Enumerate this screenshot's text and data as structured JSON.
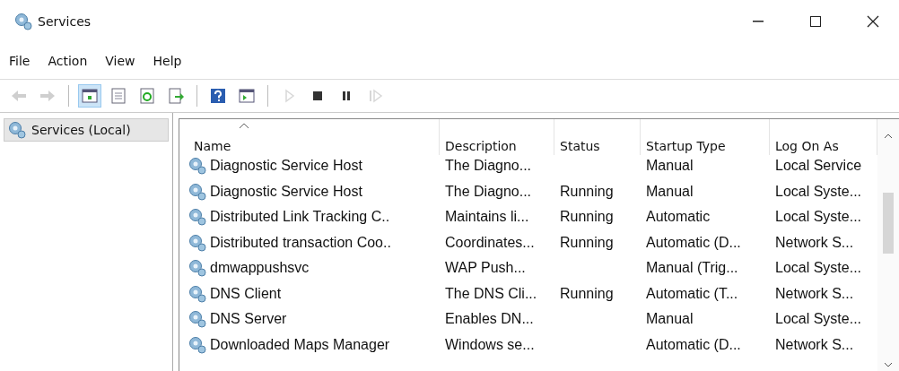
{
  "window": {
    "title": "Services"
  },
  "menu": [
    "File",
    "Action",
    "View",
    "Help"
  ],
  "toolbar": [
    {
      "kind": "back",
      "disabled": true,
      "selected": false
    },
    {
      "kind": "forward",
      "disabled": true,
      "selected": false
    },
    {
      "kind": "sep"
    },
    {
      "kind": "tree",
      "disabled": false,
      "selected": true
    },
    {
      "kind": "properties",
      "disabled": false,
      "selected": false
    },
    {
      "kind": "refresh",
      "disabled": false,
      "selected": false
    },
    {
      "kind": "export",
      "disabled": false,
      "selected": false
    },
    {
      "kind": "sep"
    },
    {
      "kind": "help",
      "disabled": false,
      "selected": false
    },
    {
      "kind": "view",
      "disabled": false,
      "selected": false
    },
    {
      "kind": "sep"
    },
    {
      "kind": "start",
      "disabled": true,
      "selected": false
    },
    {
      "kind": "stop",
      "disabled": false,
      "selected": false
    },
    {
      "kind": "pause",
      "disabled": false,
      "selected": false
    },
    {
      "kind": "resume",
      "disabled": true,
      "selected": false
    }
  ],
  "sidebar": {
    "items": [
      {
        "label": "Services (Local)",
        "selected": true
      }
    ]
  },
  "table": {
    "columns": [
      {
        "label": "Name",
        "sorted": true
      },
      {
        "label": "Description",
        "sorted": false
      },
      {
        "label": "Status",
        "sorted": false
      },
      {
        "label": "Startup Type",
        "sorted": false
      },
      {
        "label": "Log On As",
        "sorted": false
      }
    ],
    "rows": [
      {
        "name": "Diagnostic Service Host",
        "description": "The Diagno...",
        "startup_type": "Manual",
        "log_on_as": "Local Service"
      },
      {
        "name": "Diagnostic Service Host",
        "description": "The Diagno...",
        "status": "Running",
        "startup_type": "Manual",
        "log_on_as": "Local Syste..."
      },
      {
        "name": "Distributed Link Tracking C..",
        "description": "Maintains li...",
        "status": "Running",
        "startup_type": "Automatic",
        "log_on_as": "Local Syste..."
      },
      {
        "name": "Distributed transaction Coo..",
        "description": "Coordinates...",
        "status": "Running",
        "startup_type": "Automatic (D...",
        "log_on_as": "Network S..."
      },
      {
        "name": "dmwappushsvc",
        "description": "WAP Push...",
        "startup_type": "Manual (Trig...",
        "log_on_as": "Local Syste..."
      },
      {
        "name": "DNS Client",
        "description": "The DNS Cli...",
        "status": "Running",
        "startup_type": "Automatic (T...",
        "log_on_as": "Network S..."
      },
      {
        "name": "DNS Server",
        "description": "Enables DN...",
        "startup_type": "Manual",
        "log_on_as": "Local Syste..."
      },
      {
        "name": "Downloaded Maps Manager",
        "description": "Windows se...",
        "startup_type": "Automatic (D...",
        "log_on_as": "Network S..."
      }
    ]
  }
}
